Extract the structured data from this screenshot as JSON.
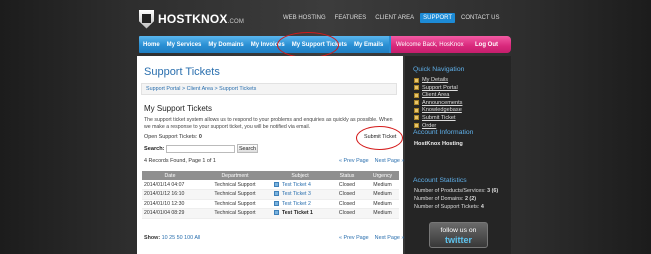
{
  "header": {
    "brand": "HOSTKNOX",
    "brand_suffix": ".COM",
    "topnav": [
      "WEB HOSTING",
      "FEATURES",
      "CLIENT AREA",
      "SUPPORT",
      "CONTACT US"
    ],
    "topnav_active": "SUPPORT"
  },
  "mainnav": {
    "items": [
      "Home",
      "My Services",
      "My Domains",
      "My Invoices",
      "My Support Tickets",
      "My Emails"
    ],
    "welcome": "Welcome Back, HosKnox",
    "logout": "Log Out"
  },
  "page": {
    "title": "Support Tickets",
    "breadcrumb": "Support Portal > Client Area > Support Tickets",
    "section_title": "My Support Tickets",
    "description": "The support ticket system allows us to respond to your problems and enquiries as quickly as possible. When we make a response to your support ticket, you will be notified via email.",
    "open_tickets_label": "Open Support Tickets:",
    "open_tickets_value": "0",
    "submit_ticket": "Submit Ticket",
    "search_label": "Search:",
    "search_value": "",
    "search_button": "Search",
    "records_info": "4 Records Found, Page 1 of 1",
    "prev_page": "« Prev Page",
    "next_page": "Next Page »",
    "show_label": "Show:",
    "show_options": "10 25 50 100 All"
  },
  "table": {
    "headers": [
      "Date",
      "Department",
      "Subject",
      "Status",
      "Urgency"
    ],
    "rows": [
      {
        "date": "2014/01/14 04:07",
        "department": "Technical Support",
        "subject": "Test Ticket 4",
        "status": "Closed",
        "urgency": "Medium"
      },
      {
        "date": "2014/01/12 16:10",
        "department": "Technical Support",
        "subject": "Test Ticket 3",
        "status": "Closed",
        "urgency": "Medium"
      },
      {
        "date": "2014/01/10 12:30",
        "department": "Technical Support",
        "subject": "Test Ticket 2",
        "status": "Closed",
        "urgency": "Medium"
      },
      {
        "date": "2014/01/04 08:29",
        "department": "Technical Support",
        "subject": "Test Ticket 1",
        "status": "Closed",
        "urgency": "Medium"
      }
    ]
  },
  "sidebar": {
    "quick_nav_title": "Quick Navigation",
    "quick_links": [
      "My Details",
      "Support Portal",
      "Client Area",
      "Announcements",
      "Knowledgebase",
      "Submit Ticket",
      "Order"
    ],
    "account_info_title": "Account Information",
    "account_name": "HostKnox Hosting",
    "stats_title": "Account Statistics",
    "stats": [
      {
        "label": "Number of Products/Services:",
        "value": "3 (6)"
      },
      {
        "label": "Number of Domains:",
        "value": "2 (2)"
      },
      {
        "label": "Number of Support Tickets:",
        "value": "4"
      }
    ],
    "twitter_follow": "follow us on",
    "twitter_brand": "twitter"
  },
  "colors": {
    "accent_blue": "#2a8fd3",
    "logout_pink": "#d8287b",
    "link": "#2a6fae",
    "annotation_red": "#d41a1a"
  }
}
